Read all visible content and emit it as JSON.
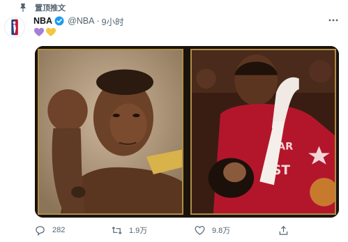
{
  "pinned": {
    "label": "置顶推文",
    "icon": "pin-icon"
  },
  "tweet": {
    "author": "NBA",
    "handle": "@NBA",
    "separator": "·",
    "time": "9小时",
    "verified": true,
    "emojis": [
      "purple-heart",
      "yellow-heart"
    ],
    "media": [
      {
        "name": "photo-kobe-portrait"
      },
      {
        "name": "photo-kobe-with-daughter"
      }
    ]
  },
  "actions": {
    "reply_count": "282",
    "retweet_count": "1.9万",
    "like_count": "9.8万"
  },
  "colors": {
    "verified": "#1d9bf0",
    "muted_text": "#536471",
    "purple_heart": "#a37fd6",
    "yellow_heart": "#f5c542",
    "frame_gold": "#b08c48"
  }
}
